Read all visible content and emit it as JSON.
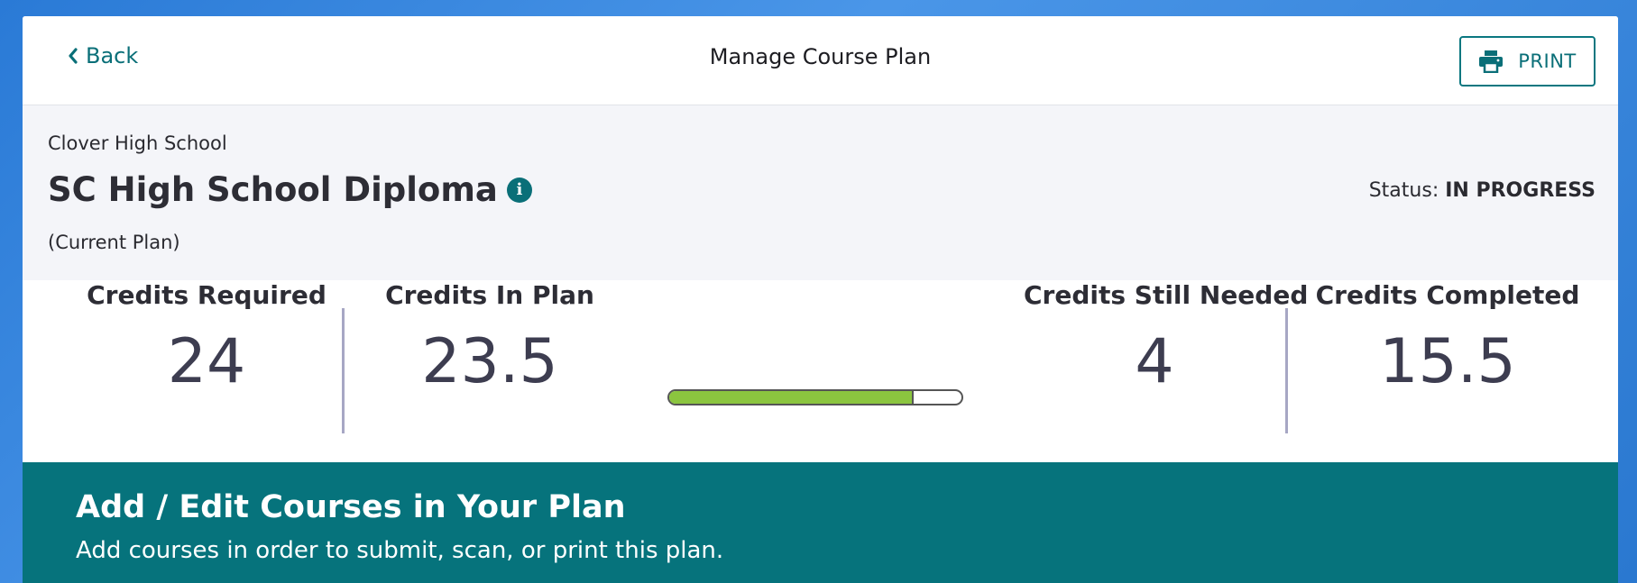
{
  "header": {
    "back_label": "Back",
    "title": "Manage Course Plan",
    "print_label": "PRINT"
  },
  "plan": {
    "school": "Clover High School",
    "name": "SC High School Diploma",
    "current_label": "(Current Plan)",
    "status_label": "Status:",
    "status_value": "IN PROGRESS"
  },
  "stats": {
    "credits_required": {
      "label": "Credits Required",
      "value": "24"
    },
    "credits_in_plan": {
      "label": "Credits In Plan",
      "value": "23.5"
    },
    "credits_still_needed": {
      "label": "Credits Still Needed",
      "value": "4"
    },
    "credits_completed": {
      "label": "Credits Completed",
      "value": "15.5"
    },
    "progress_fraction": 0.835
  },
  "edit_courses": {
    "title": "Add / Edit Courses in Your Plan",
    "subtitle": "Add courses in order to submit, scan, or print this plan."
  },
  "colors": {
    "accent_teal": "#06737c",
    "progress_green": "#8bc53f",
    "background_blue": "#2a7ad6"
  },
  "icons": {
    "back": "chevron-left-icon",
    "print": "printer-icon",
    "info": "info-icon"
  }
}
